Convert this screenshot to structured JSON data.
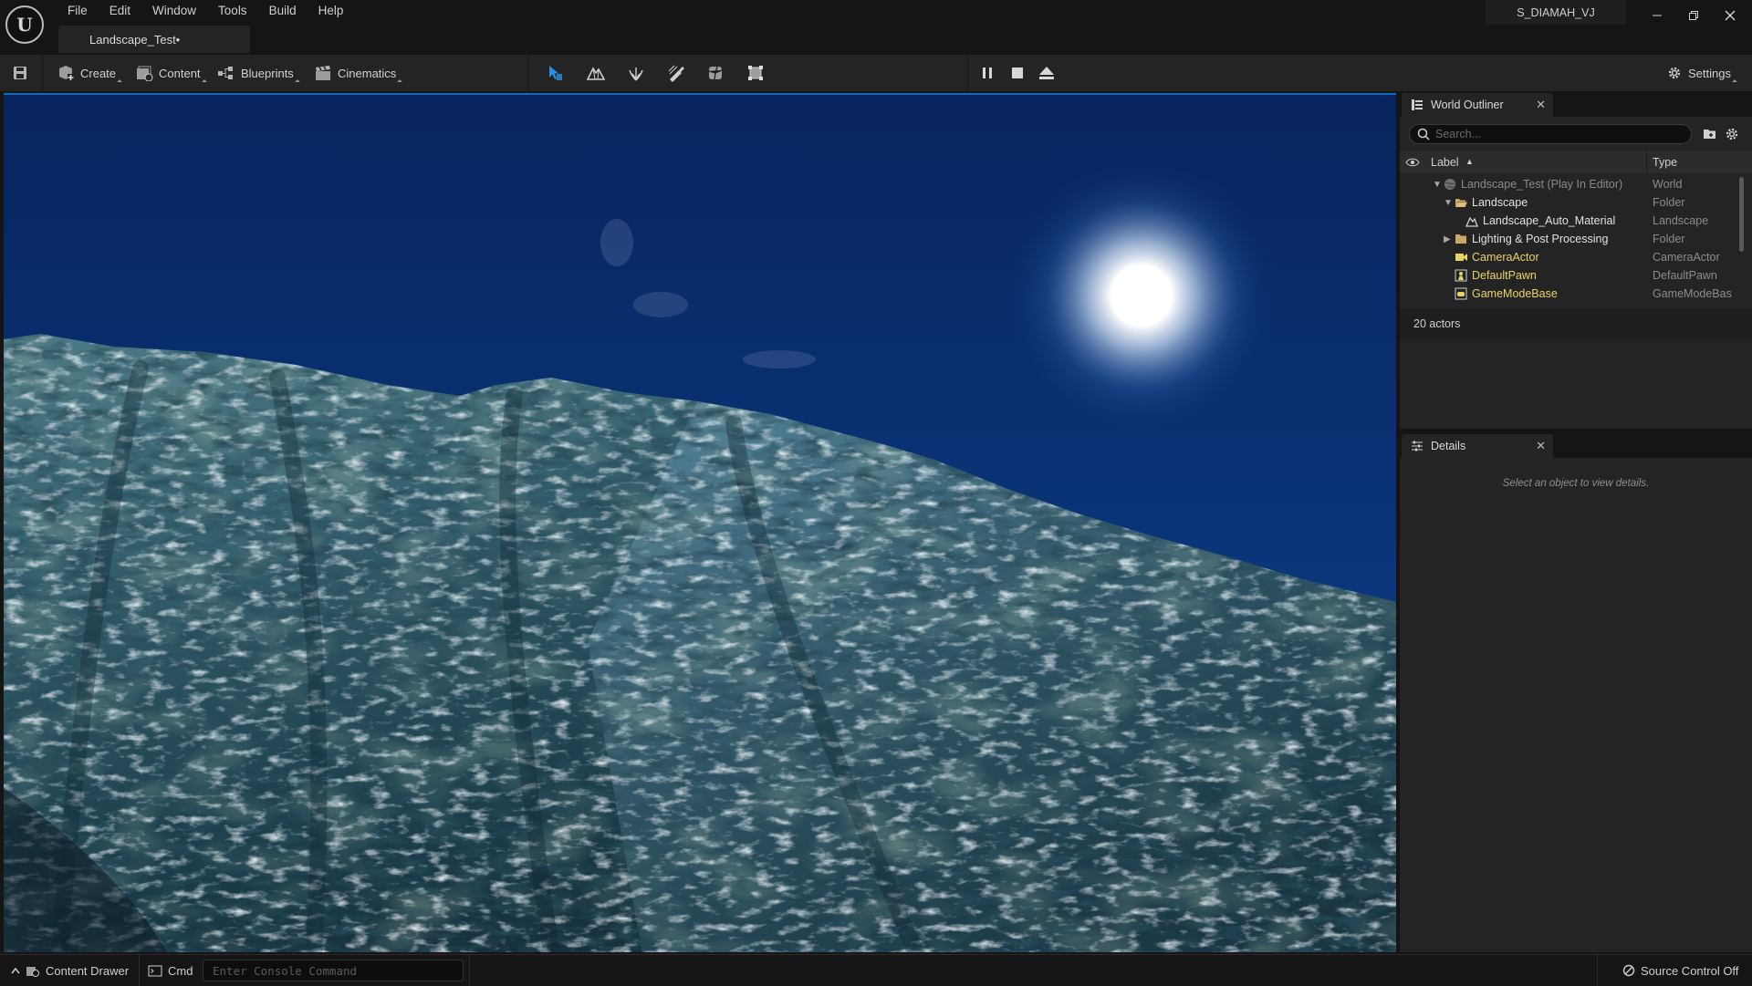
{
  "menu": [
    "File",
    "Edit",
    "Window",
    "Tools",
    "Build",
    "Help"
  ],
  "level_tab": "Landscape_Test•",
  "user": "S_DIAMAH_VJ",
  "toolbar": {
    "create": "Create",
    "content": "Content",
    "blueprints": "Blueprints",
    "cinematics": "Cinematics",
    "settings": "Settings",
    "mode_icons": [
      "select-mode-icon",
      "landscape-mode-icon",
      "foliage-mode-icon",
      "mesh-paint-mode-icon",
      "fracture-mode-icon",
      "geometry-mode-icon"
    ],
    "play_icons": [
      "pause-icon",
      "stop-icon",
      "eject-icon"
    ]
  },
  "outliner": {
    "tab": "World Outliner",
    "search_placeholder": "Search...",
    "col_label": "Label",
    "col_type": "Type",
    "rows": [
      {
        "label": "Landscape_Test (Play In Editor)",
        "type": "World",
        "icon": "world-icon",
        "arrow": "expanded"
      },
      {
        "label": "Landscape",
        "type": "Folder",
        "icon": "folder-icon",
        "arrow": "expanded"
      },
      {
        "label": "Landscape_Auto_Material",
        "type": "Landscape",
        "icon": "landscape-icon",
        "arrow": "none"
      },
      {
        "label": "Lighting & Post Processing",
        "type": "Folder",
        "icon": "folder-icon",
        "arrow": "collapsed"
      },
      {
        "label": "CameraActor",
        "type": "CameraActor",
        "icon": "camera-icon",
        "arrow": "none"
      },
      {
        "label": "DefaultPawn",
        "type": "DefaultPawn",
        "icon": "pawn-icon",
        "arrow": "none"
      },
      {
        "label": "GameModeBase",
        "type": "GameModeBas",
        "icon": "gamemode-icon",
        "arrow": "none"
      }
    ],
    "actor_count": "20 actors"
  },
  "details": {
    "tab": "Details",
    "message": "Select an object to view details."
  },
  "statusbar": {
    "content_drawer": "Content Drawer",
    "cmd": "Cmd",
    "console_placeholder": "Enter Console Command",
    "source_control": "Source Control Off"
  },
  "colors": {
    "accent_blue": "#0e6cc4",
    "actor_yellow": "#e8d36a",
    "folder_tan": "#c9a86a"
  }
}
